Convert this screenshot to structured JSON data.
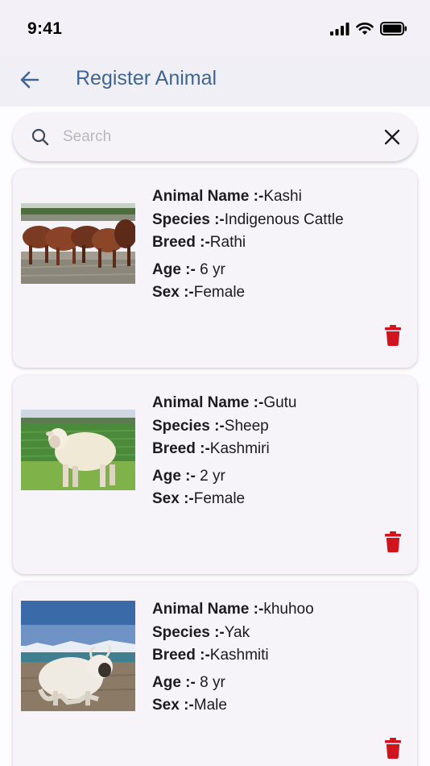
{
  "status_bar": {
    "time": "9:41"
  },
  "app_bar": {
    "title": "Register Animal"
  },
  "search": {
    "placeholder": "Search",
    "value": ""
  },
  "colors": {
    "accent": "#3e6694",
    "delete": "#d0141e",
    "background": "#fdfcff"
  },
  "animals": [
    {
      "name_label": "Animal Name :-",
      "name": "Kashi",
      "species_label": "Species :-",
      "species": "Indigenous Cattle",
      "breed_label": "Breed :-",
      "breed": "Rathi",
      "age_label": "Age :-",
      "age": " 6 yr",
      "sex_label": "Sex :-",
      "sex": "Female",
      "image": "cattle-herd-photo"
    },
    {
      "name_label": "Animal Name :-",
      "name": "Gutu",
      "species_label": "Species :-",
      "species": "Sheep",
      "breed_label": "Breed :-",
      "breed": "Kashmiri",
      "age_label": "Age :-",
      "age": " 2 yr",
      "sex_label": "Sex :-",
      "sex": "Female",
      "image": "sheep-photo"
    },
    {
      "name_label": "Animal Name :-",
      "name": "khuhoo",
      "species_label": "Species :-",
      "species": "Yak",
      "breed_label": "Breed :-",
      "breed": "Kashmiti",
      "age_label": "Age :-",
      "age": " 8 yr",
      "sex_label": "Sex :-",
      "sex": "Male",
      "image": "yak-photo"
    }
  ]
}
